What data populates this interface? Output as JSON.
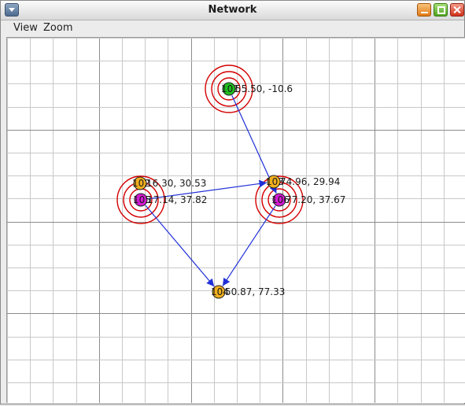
{
  "window": {
    "title": "Network"
  },
  "menubar": {
    "items": [
      "View",
      "Zoom"
    ]
  },
  "colors": {
    "edge": "#1f2fd8",
    "ring": "#d40000",
    "node_green": "#1fbf1f",
    "node_orange": "#f2b01e",
    "node_magenta": "#d21ad2"
  },
  "nodes": [
    {
      "id": "n1",
      "badge": "101",
      "label": "55.50, -10.6",
      "color": "green",
      "rings": true
    },
    {
      "id": "n2",
      "badge": "102",
      "label": "16.30, 30.53",
      "color": "orange",
      "rings": false
    },
    {
      "id": "n3",
      "badge": "105",
      "label": "17.14, 37.82",
      "color": "magenta",
      "rings": true
    },
    {
      "id": "n4",
      "badge": "103",
      "label": "74.96, 29.94",
      "color": "orange",
      "rings": false
    },
    {
      "id": "n5",
      "badge": "106",
      "label": "77.20, 37.67",
      "color": "magenta",
      "rings": true
    },
    {
      "id": "n6",
      "badge": "104",
      "label": "50.87, 77.33",
      "color": "orange",
      "rings": false
    }
  ],
  "edges": [
    {
      "from": "n1",
      "to": "n5"
    },
    {
      "from": "n3",
      "to": "n4"
    },
    {
      "from": "n3",
      "to": "n6"
    },
    {
      "from": "n5",
      "to": "n6"
    }
  ]
}
